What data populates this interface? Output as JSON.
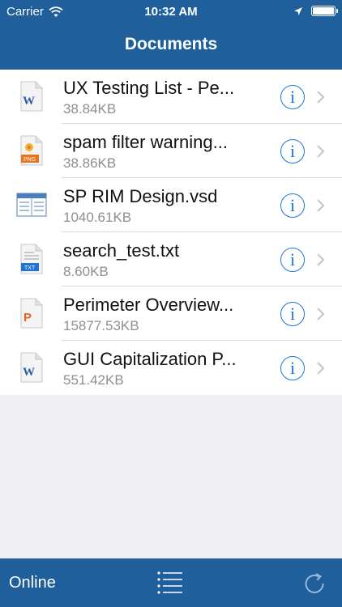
{
  "status_bar": {
    "carrier": "Carrier",
    "time": "10:32 AM"
  },
  "nav": {
    "title": "Documents"
  },
  "documents": [
    {
      "name": "UX Testing List - Pe...",
      "size": "38.84KB",
      "icon": "word-doc-icon"
    },
    {
      "name": "spam filter warning...",
      "size": "38.86KB",
      "icon": "png-image-icon"
    },
    {
      "name": "SP RIM Design.vsd",
      "size": "1040.61KB",
      "icon": "visio-doc-icon"
    },
    {
      "name": "search_test.txt",
      "size": "8.60KB",
      "icon": "txt-doc-icon"
    },
    {
      "name": "Perimeter Overview...",
      "size": "15877.53KB",
      "icon": "powerpoint-doc-icon"
    },
    {
      "name": "GUI Capitalization P...",
      "size": "551.42KB",
      "icon": "word-doc-icon"
    }
  ],
  "icons": {
    "png_label": "PNG",
    "txt_label": "TXT",
    "word_letter": "W",
    "powerpoint_letter": "P",
    "info_glyph": "i"
  },
  "bottom_bar": {
    "status": "Online"
  },
  "colors": {
    "bar_blue": "#1f5f9c",
    "accent_blue": "#1d74d6",
    "secondary_text": "#8e8e93",
    "background": "#efeff4"
  }
}
